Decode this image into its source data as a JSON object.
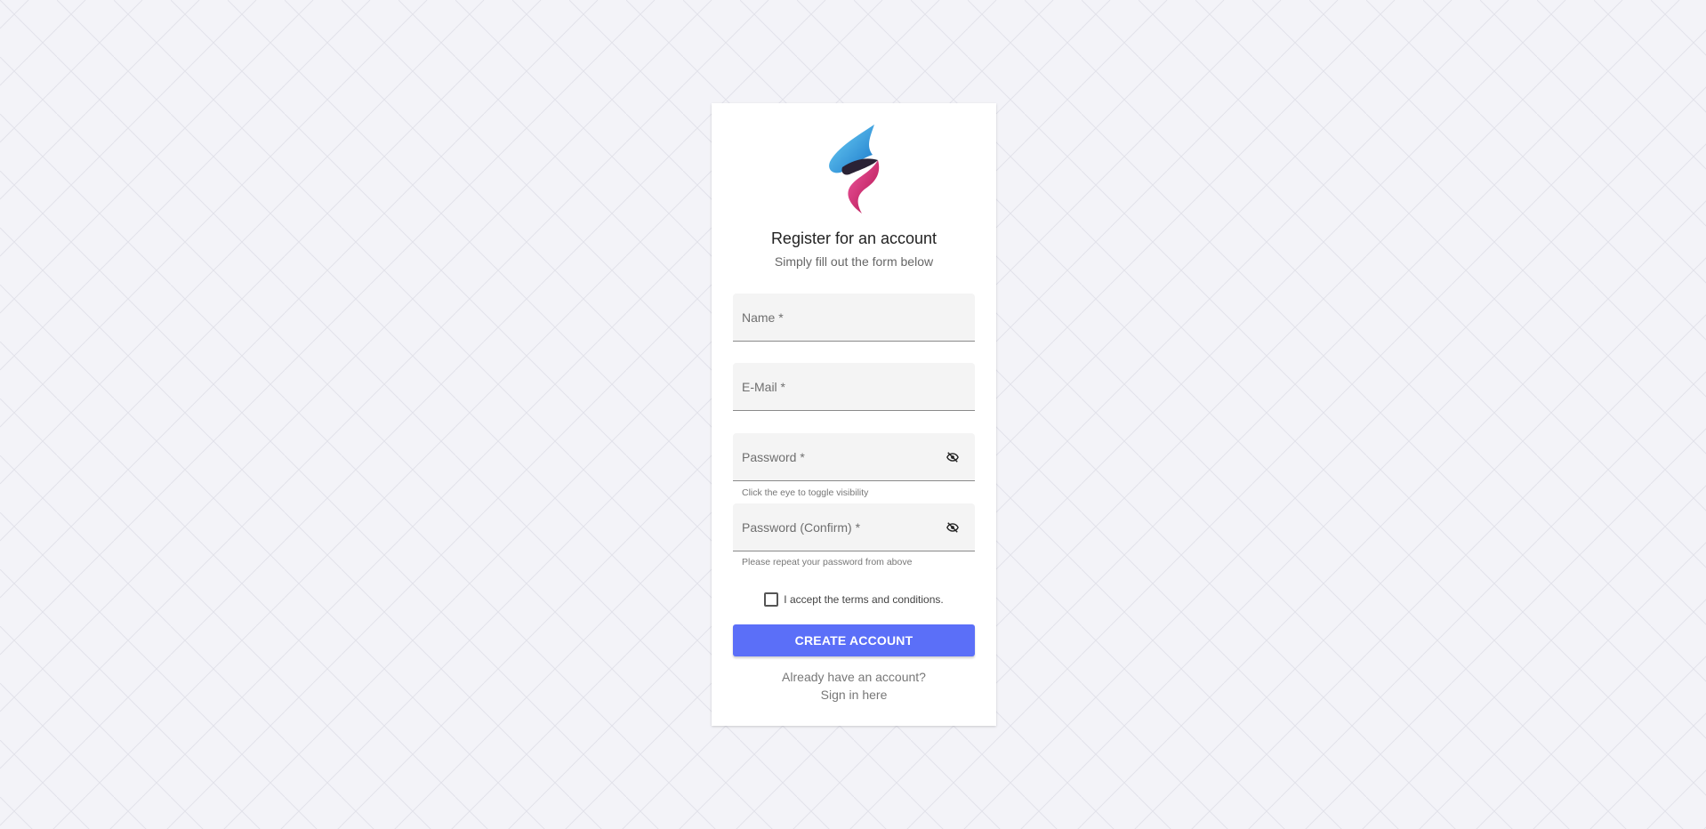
{
  "page": {
    "title": "Register for an account",
    "subtitle": "Simply fill out the form below"
  },
  "form": {
    "name": {
      "placeholder": "Name *",
      "value": ""
    },
    "email": {
      "placeholder": "E-Mail *",
      "value": ""
    },
    "password": {
      "placeholder": "Password *",
      "value": "",
      "hint": "Click the eye to toggle visibility",
      "toggle_icon": "eye-off-icon"
    },
    "password_confirm": {
      "placeholder": "Password (Confirm) *",
      "value": "",
      "hint": "Please repeat your password from above",
      "toggle_icon": "eye-off-icon"
    },
    "terms": {
      "label": "I accept the terms and conditions.",
      "checked": false
    },
    "submit_label": "CREATE ACCOUNT"
  },
  "footer": {
    "prompt": "Already have an account?",
    "link": "Sign in here"
  },
  "colors": {
    "background": "#f3f3f8",
    "accent": "#5b6ff8",
    "logo_blue": "#1f9fe0",
    "logo_pink": "#e8337f"
  }
}
